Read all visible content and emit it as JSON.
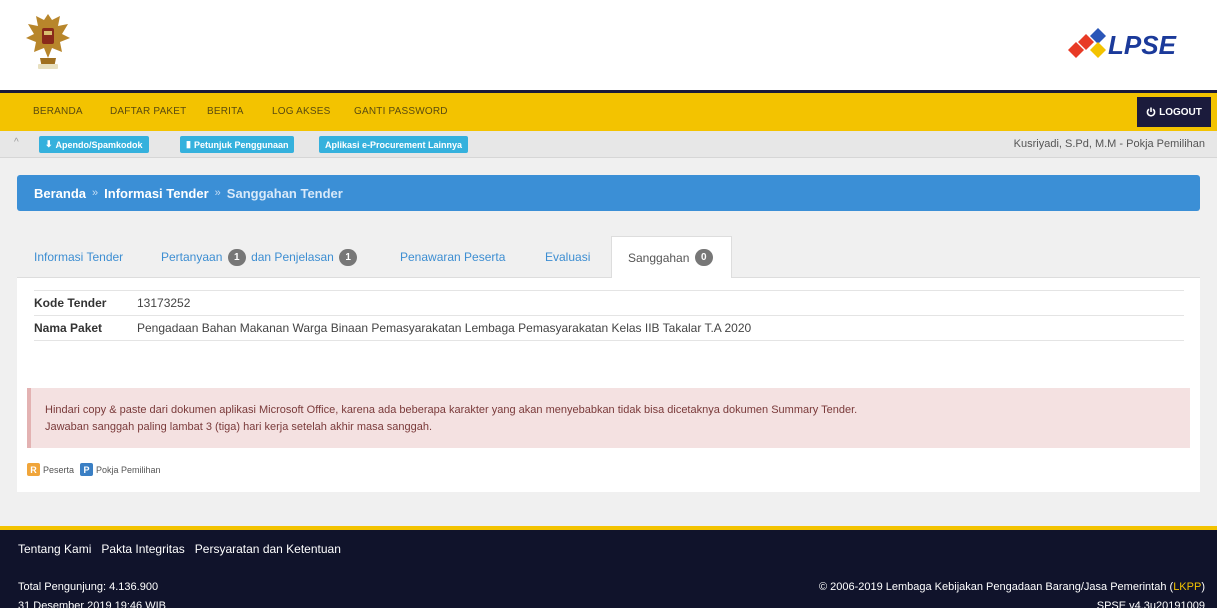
{
  "nav": {
    "items": [
      "BERANDA",
      "DAFTAR PAKET",
      "BERITA",
      "LOG AKSES",
      "GANTI PASSWORD"
    ],
    "logout": "LOGOUT"
  },
  "subbar": {
    "apendo": "Apendo/Spamkodok",
    "petunjuk": "Petunjuk Penggunaan",
    "aplikasi": "Aplikasi e-Procurement Lainnya",
    "user": "Kusriyadi, S.Pd, M.M - Pokja Pemilihan"
  },
  "breadcrumb": {
    "home": "Beranda",
    "sep": "»",
    "info": "Informasi Tender",
    "current": "Sanggahan Tender"
  },
  "tabs": {
    "informasi": "Informasi Tender",
    "pertanyaan": "Pertanyaan",
    "pertanyaan_count": "1",
    "dan_penjelasan": "dan Penjelasan",
    "penjelasan_count": "1",
    "penawaran": "Penawaran Peserta",
    "evaluasi": "Evaluasi",
    "sanggahan": "Sanggahan",
    "sanggahan_count": "0"
  },
  "tender": {
    "kode_label": "Kode Tender",
    "kode_value": "13173252",
    "nama_label": "Nama Paket",
    "nama_value": "Pengadaan Bahan Makanan Warga Binaan Pemasyarakatan Lembaga Pemasyarakatan Kelas IIB Takalar T.A 2020"
  },
  "alert": {
    "line1": "Hindari copy & paste dari dokumen aplikasi Microsoft Office, karena ada beberapa karakter yang akan menyebabkan tidak bisa dicetaknya dokumen Summary Tender.",
    "line2": "Jawaban sanggah paling lambat 3 (tiga) hari kerja setelah akhir masa sanggah."
  },
  "legend": {
    "r_letter": "R",
    "r_label": "Peserta",
    "p_letter": "P",
    "p_label": "Pokja Pemilihan"
  },
  "footer": {
    "links": [
      "Tentang Kami",
      "Pakta Integritas",
      "Persyaratan dan Ketentuan"
    ],
    "visitors": "Total Pengunjung: 4.136.900",
    "datetime": "31 Desember 2019 19:46 WIB",
    "copyright": "© 2006-2019 Lembaga Kebijakan Pengadaan Barang/Jasa Pemerintah (",
    "lkpp": "LKPP",
    "close_paren": ")",
    "version": "SPSE v4.3u20191009"
  },
  "logo": {
    "lpse_text": "LPSE"
  },
  "colors": {
    "nav_bg": "#f3c300",
    "footer_bg": "#10132b",
    "breadcrumb_bg": "#3b8fd6",
    "button_bg": "#35b1dd"
  }
}
